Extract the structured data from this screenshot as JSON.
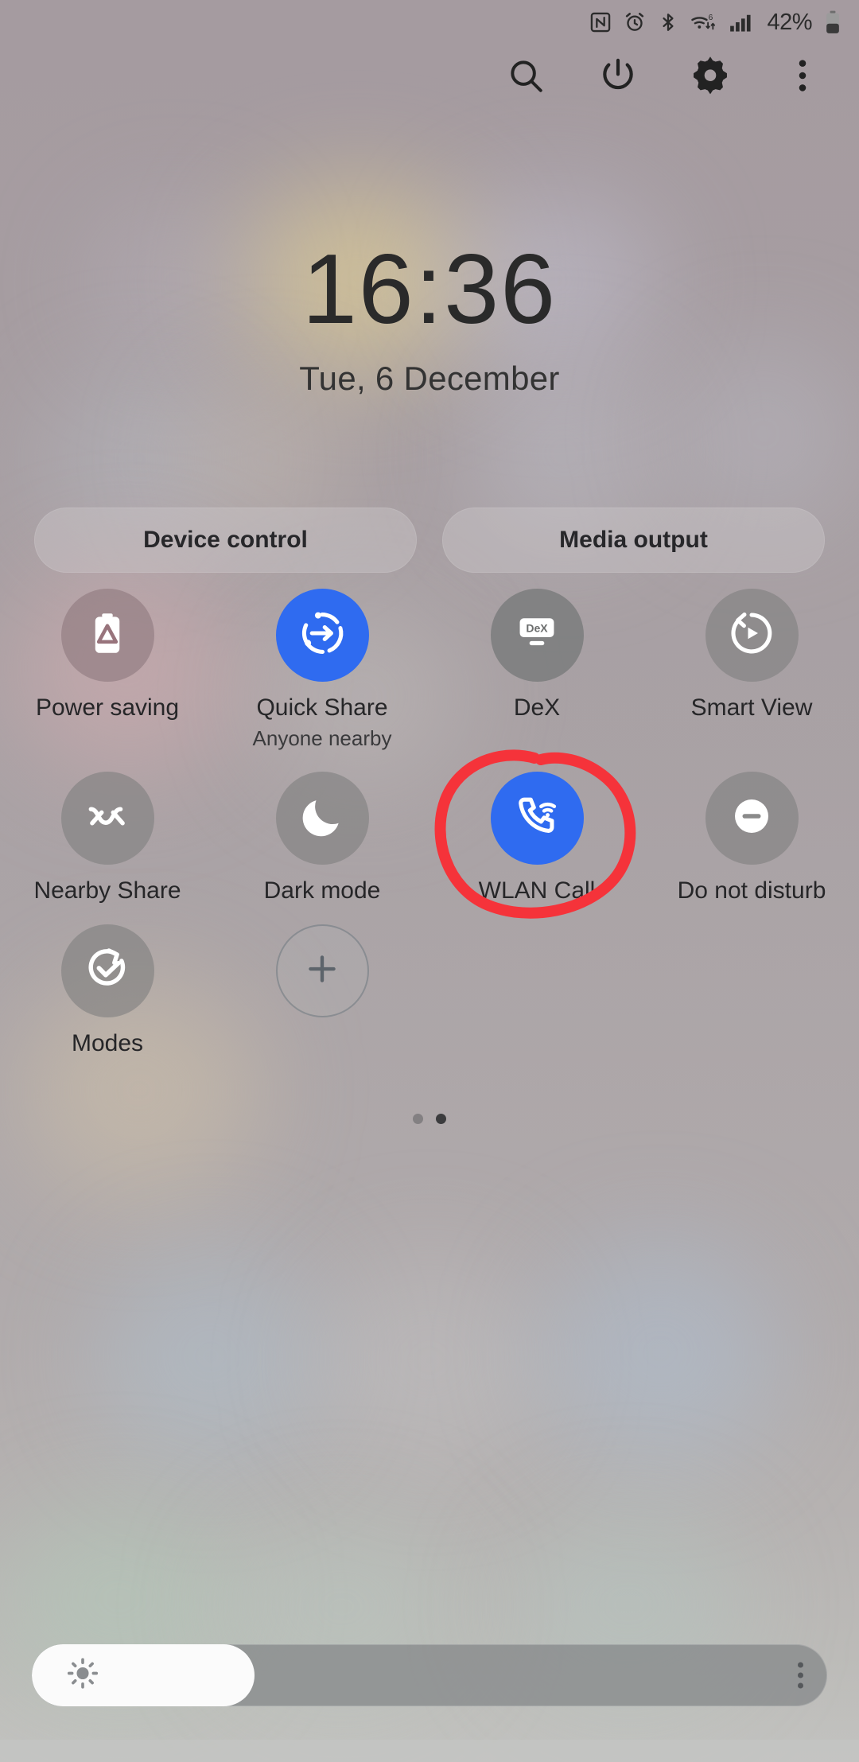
{
  "status_bar": {
    "icons": [
      "nfc-icon",
      "alarm-icon",
      "bluetooth-icon",
      "wifi-6-icon",
      "signal-bars-icon"
    ],
    "battery_percent": "42%",
    "battery_icon": "battery-icon"
  },
  "toolbar": {
    "buttons": [
      {
        "name": "search-icon",
        "label": "Search"
      },
      {
        "name": "power-icon",
        "label": "Power off"
      },
      {
        "name": "gear-icon",
        "label": "Settings"
      },
      {
        "name": "overflow-menu-icon",
        "label": "More options"
      }
    ]
  },
  "clock": {
    "time": "16:36",
    "date": "Tue, 6 December"
  },
  "pills": [
    {
      "label": "Device control",
      "name": "device-control-pill"
    },
    {
      "label": "Media output",
      "name": "media-output-pill"
    }
  ],
  "tiles": [
    [
      {
        "label": "Power saving",
        "sub": "",
        "state": "off",
        "icon": "battery-power-saving-icon",
        "name": "tile-power-saving"
      },
      {
        "label": "Quick Share",
        "sub": "Anyone nearby",
        "state": "on",
        "icon": "quick-share-icon",
        "name": "tile-quick-share"
      },
      {
        "label": "DeX",
        "sub": "",
        "state": "off",
        "icon": "dex-monitor-icon",
        "name": "tile-dex"
      },
      {
        "label": "Smart View",
        "sub": "",
        "state": "off",
        "icon": "smart-view-icon",
        "name": "tile-smart-view"
      }
    ],
    [
      {
        "label": "Nearby Share",
        "sub": "",
        "state": "off",
        "icon": "nearby-share-icon",
        "name": "tile-nearby-share"
      },
      {
        "label": "Dark mode",
        "sub": "",
        "state": "off",
        "icon": "moon-icon",
        "name": "tile-dark-mode"
      },
      {
        "label": "WLAN Call",
        "sub": "",
        "state": "on",
        "icon": "wlan-call-icon",
        "name": "tile-wlan-call"
      },
      {
        "label": "Do not disturb",
        "sub": "",
        "state": "off",
        "icon": "do-not-disturb-icon",
        "name": "tile-do-not-disturb"
      }
    ],
    [
      {
        "label": "Modes",
        "sub": "",
        "state": "off",
        "icon": "modes-icon",
        "name": "tile-modes"
      },
      {
        "label": "",
        "sub": "",
        "state": "add",
        "icon": "plus-icon",
        "name": "tile-add-button"
      }
    ]
  ],
  "dex_icon_text": "DeX",
  "pager": {
    "pages": 2,
    "active": 2
  },
  "brightness": {
    "value_percent": 28,
    "icon": "brightness-sun-icon",
    "menu_icon": "overflow-menu-icon"
  },
  "annotation": {
    "shape": "hand-drawn-circle",
    "color": "#f5333a",
    "target": "tile-do-not-disturb"
  },
  "colors": {
    "accent_blue": "#2f6bf0",
    "annotation_red": "#f5333a",
    "tile_off": "#808080",
    "text_primary": "#262628"
  }
}
